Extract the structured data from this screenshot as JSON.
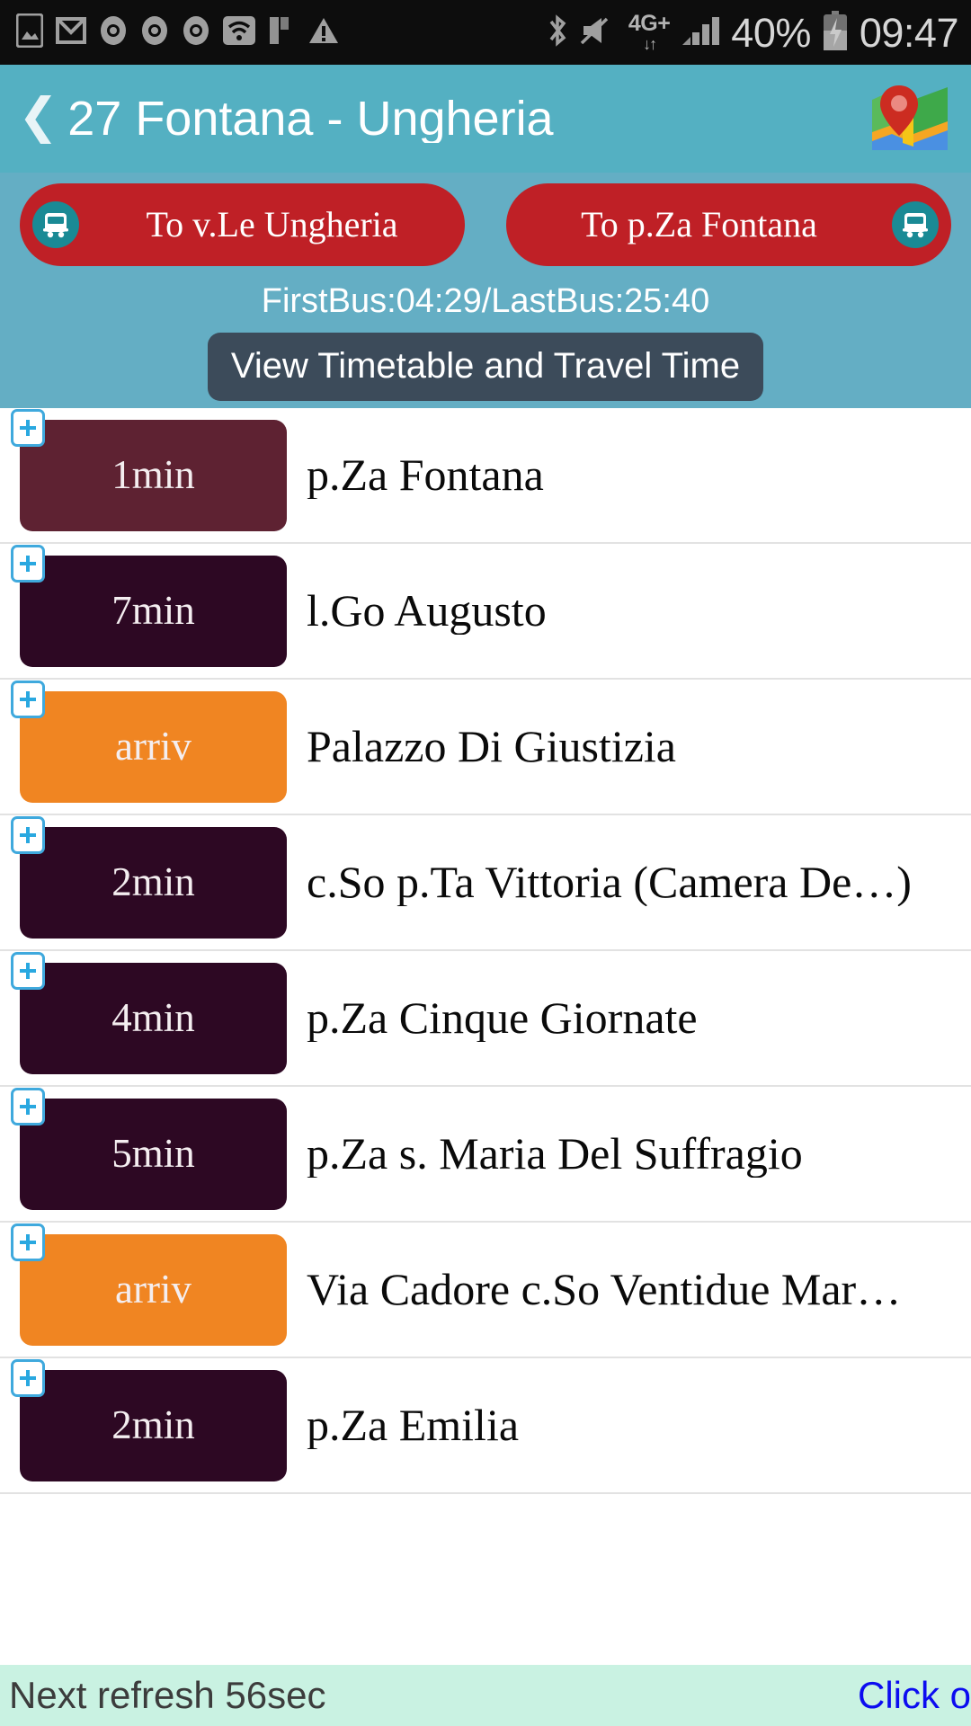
{
  "statusbar": {
    "icons_left": [
      "gallery-icon",
      "gmail-icon",
      "chrome-icon",
      "chrome-icon",
      "chrome-icon",
      "wifi-icon",
      "flipboard-icon",
      "warning-icon"
    ],
    "bluetooth_icon": "bluetooth-icon",
    "mute_icon": "volume-mute-icon",
    "network_type": "4G+",
    "network_arrows": "↓↑",
    "signal_icon": "signal-bars-icon",
    "battery_percent": "40%",
    "battery_icon": "battery-charging-icon",
    "clock": "09:47"
  },
  "header": {
    "back_icon": "❮",
    "title": "27 Fontana - Ungheria",
    "map_icon": "google-maps-icon"
  },
  "subpanel": {
    "direction_buttons": [
      {
        "label": "To v.Le Ungheria",
        "icon": "bus-icon",
        "icon_side": "left"
      },
      {
        "label": "To p.Za Fontana",
        "icon": "bus-icon",
        "icon_side": "right"
      }
    ],
    "first_last_bus": "FirstBus:04:29/LastBus:25:40",
    "timetable_label": "View Timetable and Travel Time"
  },
  "colors": {
    "header_bg": "#54b0c2",
    "subpanel_bg": "#64aec4",
    "direction_button": "#bf2026",
    "bus_badge": "#1a8a95",
    "timetable_button": "#3c4b5a",
    "badge_first": "#5e2232",
    "badge_dark": "#2d0823",
    "badge_arriving": "#f08522",
    "plus_border": "#3fa9dd",
    "plus_glyph": "#29a8e0",
    "bottom_bar": "#c9f2e2",
    "link": "#0c0cf0"
  },
  "stops": [
    {
      "eta": "1min",
      "name": "p.Za Fontana",
      "badge_color": "#5e2232",
      "add_icon": "plus-icon"
    },
    {
      "eta": "7min",
      "name": "l.Go Augusto",
      "badge_color": "#2d0823",
      "add_icon": "plus-icon"
    },
    {
      "eta": "arriv",
      "name": "Palazzo Di Giustizia",
      "badge_color": "#f08522",
      "add_icon": "plus-icon"
    },
    {
      "eta": "2min",
      "name": "c.So p.Ta Vittoria (Camera De…)",
      "badge_color": "#2d0823",
      "add_icon": "plus-icon"
    },
    {
      "eta": "4min",
      "name": "p.Za Cinque Giornate",
      "badge_color": "#2d0823",
      "add_icon": "plus-icon"
    },
    {
      "eta": "5min",
      "name": "p.Za s. Maria Del Suffragio",
      "badge_color": "#2d0823",
      "add_icon": "plus-icon"
    },
    {
      "eta": "arriv",
      "name": "Via Cadore c.So Ventidue Mar…",
      "badge_color": "#f08522",
      "add_icon": "plus-icon"
    },
    {
      "eta": "2min",
      "name": "p.Za Emilia",
      "badge_color": "#2d0823",
      "add_icon": "plus-icon"
    }
  ],
  "bottombar": {
    "refresh": "Next refresh 56sec",
    "link": "Click or"
  }
}
